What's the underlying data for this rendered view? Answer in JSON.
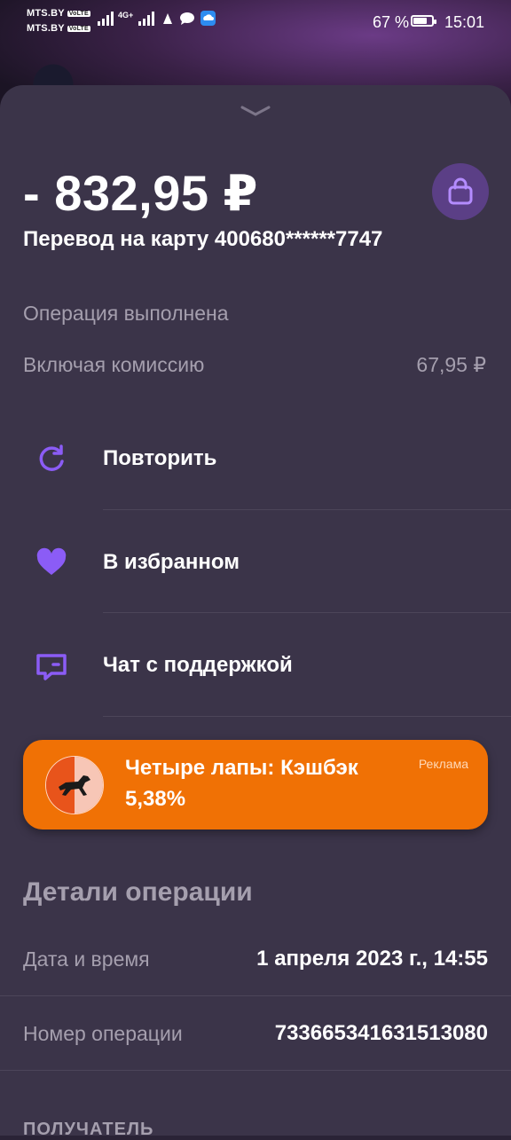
{
  "status_bar": {
    "carrier1": "MTS.BY",
    "carrier2": "MTS.BY",
    "volte": "VoLTE",
    "network": "4G+",
    "battery": "67 %",
    "battery_level": 0.67,
    "time": "15:01"
  },
  "transaction": {
    "amount": "- 832,95 ₽",
    "description": "Перевод на карту 400680******7747",
    "status": "Операция выполнена",
    "fee_label": "Включая комиссию",
    "fee_value": "67,95 ₽",
    "category_icon": "shopping-bag-icon"
  },
  "actions": [
    {
      "label": "Повторить",
      "icon": "refresh-icon"
    },
    {
      "label": "В избранном",
      "icon": "heart-icon"
    },
    {
      "label": "Чат с поддержкой",
      "icon": "chat-icon"
    }
  ],
  "ad": {
    "title": "Четыре лапы: Кэшбэк",
    "subtitle": "5,38%",
    "tag": "Реклама"
  },
  "details": {
    "title": "Детали операции",
    "rows": [
      {
        "label": "Дата и время",
        "value": "1 апреля 2023 г., 14:55"
      },
      {
        "label": "Номер операции",
        "value": "733665341631513080"
      }
    ],
    "recipient_header": "ПОЛУЧАТЕЛЬ"
  },
  "colors": {
    "background": "#3b3449",
    "accent": "#8b5cf6",
    "ad_orange": "#f07105",
    "muted_text": "#a59fae"
  }
}
